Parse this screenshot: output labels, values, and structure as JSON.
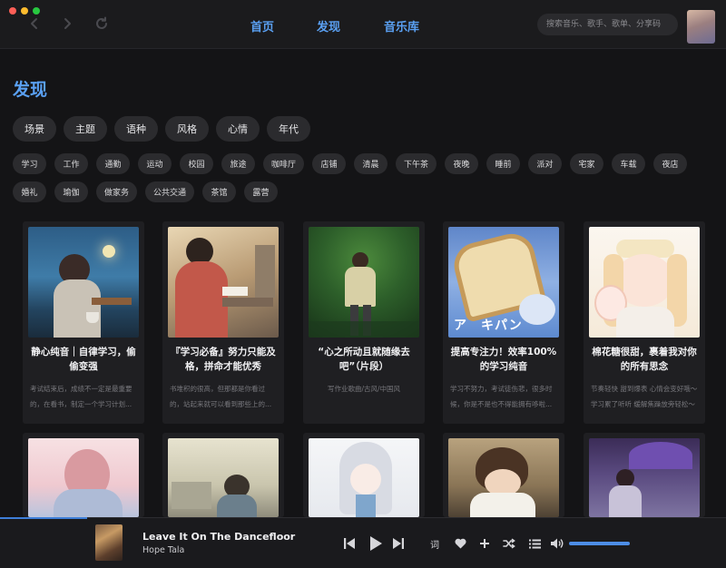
{
  "header": {
    "tabs": [
      "首页",
      "发现",
      "音乐库"
    ],
    "search_placeholder": "搜索音乐、歌手、歌单、分享码"
  },
  "page_title": "发现",
  "categories": [
    "场景",
    "主题",
    "语种",
    "风格",
    "心情",
    "年代"
  ],
  "tags_row1": [
    "学习",
    "工作",
    "通勤",
    "运动",
    "校园",
    "旅途",
    "咖啡厅",
    "店铺",
    "清晨",
    "下午茶",
    "夜晚",
    "睡前",
    "派对",
    "宅家",
    "车载",
    "夜店"
  ],
  "tags_row2": [
    "婚礼",
    "瑜伽",
    "做家务",
    "公共交通",
    "茶馆",
    "露营"
  ],
  "cards": [
    {
      "title": "静心纯音｜自律学习，偷偷变强",
      "desc": "考试结束后，成绩不一定是最重要的，在看书，制定一个学习计划..."
    },
    {
      "title": "『学习必备』努力只能及格，拼命才能优秀",
      "desc": "书堆积的很高，但那都是你看过的，站起来就可以看到那些上的..."
    },
    {
      "title": "“心之所动且就随缘去吧”（片段）",
      "desc": "写作业歌曲/古风/中国风"
    },
    {
      "title": "提高专注力！效率100%的学习纯音",
      "desc": "学习不努力，考试徒伤悲，很多时候，你是不是也不得能拥有哆啦..."
    },
    {
      "title": "棉花糖很甜，裹着我对你的所有思念",
      "desc": "节奏轻快 甜到爆表 心情会变好哦～ 学习累了听听 缓解焦躁放旁轻松～"
    },
    {
      "title": "",
      "desc": ""
    },
    {
      "title": "",
      "desc": ""
    },
    {
      "title": "",
      "desc": ""
    },
    {
      "title": "",
      "desc": ""
    },
    {
      "title": "",
      "desc": ""
    }
  ],
  "player": {
    "song": "Leave It On The Dancefloor",
    "artist": "Hope Tala",
    "lyrics_label": "词",
    "progress": 0.12,
    "volume": 1.0
  },
  "colors": {
    "accent": "#5aa0f2",
    "background": "#141416",
    "chip": "#2b2b2e"
  },
  "icons": [
    "back-arrow-icon",
    "forward-arrow-icon",
    "refresh-icon",
    "previous-track-icon",
    "play-icon",
    "next-track-icon",
    "heart-icon",
    "plus-icon",
    "shuffle-icon",
    "playlist-icon",
    "volume-icon"
  ]
}
